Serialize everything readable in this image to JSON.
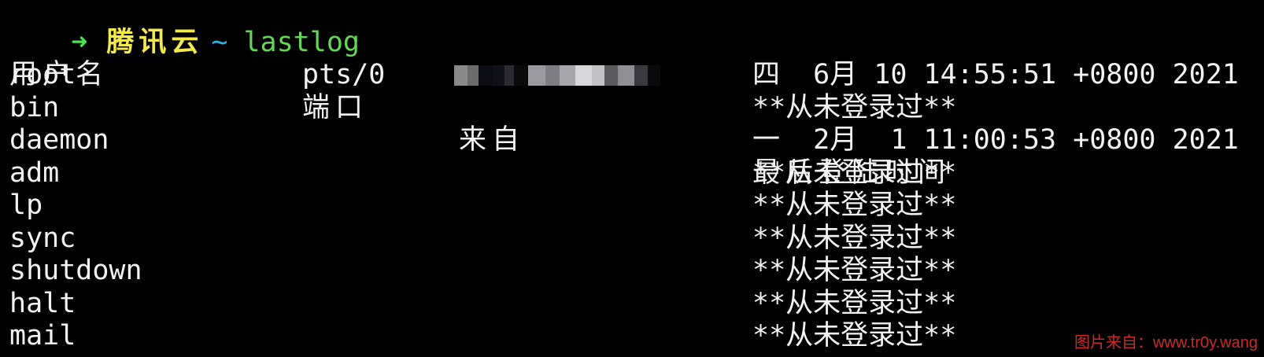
{
  "prompt": {
    "arrow": "➜",
    "host": "腾讯云",
    "cwd": "~",
    "command": "lastlog"
  },
  "table": {
    "headers": [
      "用户名",
      "端口",
      "来自",
      "最后登陆时间"
    ],
    "rows": [
      {
        "user": "root",
        "port": "pts/0",
        "from_redacted": true,
        "last_login": "四  6月 10 14:55:51 +0800 2021"
      },
      {
        "user": "bin",
        "port": "",
        "from_redacted": false,
        "last_login": "**从未登录过**"
      },
      {
        "user": "daemon",
        "port": "",
        "from_redacted": false,
        "last_login": "一  2月  1 11:00:53 +0800 2021"
      },
      {
        "user": "adm",
        "port": "",
        "from_redacted": false,
        "last_login": "**从未登录过**"
      },
      {
        "user": "lp",
        "port": "",
        "from_redacted": false,
        "last_login": "**从未登录过**"
      },
      {
        "user": "sync",
        "port": "",
        "from_redacted": false,
        "last_login": "**从未登录过**"
      },
      {
        "user": "shutdown",
        "port": "",
        "from_redacted": false,
        "last_login": "**从未登录过**"
      },
      {
        "user": "halt",
        "port": "",
        "from_redacted": false,
        "last_login": "**从未登录过**"
      },
      {
        "user": "mail",
        "port": "",
        "from_redacted": false,
        "last_login": "**从未登录过**"
      }
    ]
  },
  "watermark": "图片来自：www.tr0y.wang",
  "colors": {
    "background": "#000000",
    "text": "#f2f2f2",
    "arrow": "#4ee24e",
    "host": "#f2e94e",
    "tilde": "#2bb3e6",
    "command": "#65d65a",
    "watermark": "#c92b2b"
  }
}
